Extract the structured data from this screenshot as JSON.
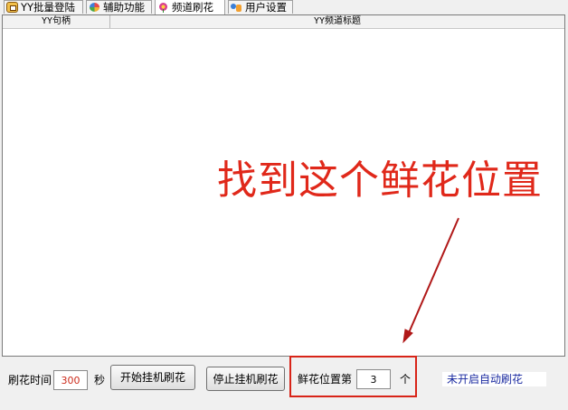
{
  "tabs": [
    {
      "label": "YY批量登陆",
      "icon": "login-icon",
      "active": false
    },
    {
      "label": "辅助功能",
      "icon": "tools-icon",
      "active": false
    },
    {
      "label": "频道刷花",
      "icon": "flower-icon",
      "active": true
    },
    {
      "label": "用户设置",
      "icon": "user-settings-icon",
      "active": false
    }
  ],
  "list": {
    "columns": [
      "YY句柄",
      "YY频道标题"
    ]
  },
  "annotation": {
    "text": "找到这个鲜花位置",
    "color": "#e0281a"
  },
  "controls": {
    "interval_label": "刷花时间",
    "interval_value": "300",
    "interval_unit": "秒",
    "start_button": "开始挂机刷花",
    "stop_button": "停止挂机刷花",
    "position_label": "鲜花位置第",
    "position_value": "3",
    "position_unit": "个",
    "status": "未开启自动刷花"
  }
}
